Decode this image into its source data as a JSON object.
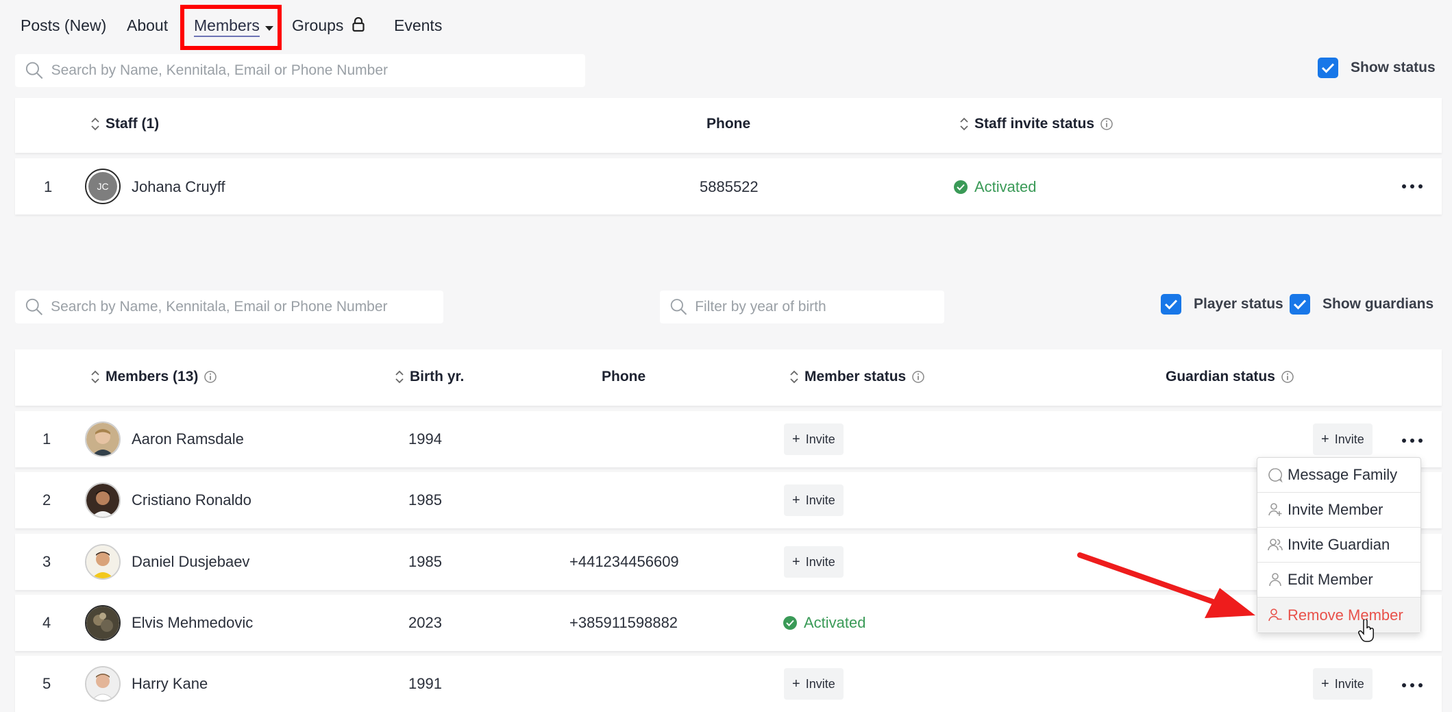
{
  "nav": {
    "items": [
      {
        "label": "Posts (New)"
      },
      {
        "label": "About"
      },
      {
        "label": "Members"
      },
      {
        "label": "Groups"
      },
      {
        "label": "Events"
      }
    ]
  },
  "staff_section": {
    "search_placeholder": "Search by Name, Kennitala, Email or Phone Number",
    "show_status_label": "Show status",
    "headers": {
      "name": "Staff (1)",
      "phone": "Phone",
      "invite_status": "Staff invite status"
    },
    "rows": [
      {
        "num": "1",
        "initials": "JC",
        "name": "Johana Cruyff",
        "phone": "5885522",
        "status": "Activated"
      }
    ]
  },
  "members_section": {
    "search_placeholder": "Search by Name, Kennitala, Email or Phone Number",
    "year_placeholder": "Filter by year of birth",
    "player_status_label": "Player status",
    "show_guardians_label": "Show guardians",
    "headers": {
      "name": "Members (13)",
      "birth": "Birth yr.",
      "phone": "Phone",
      "member_status": "Member status",
      "guardian_status": "Guardian status"
    },
    "invite_label": "Invite",
    "rows": [
      {
        "num": "1",
        "name": "Aaron Ramsdale",
        "birth": "1994",
        "phone": "",
        "member_status": "Invite",
        "guardian_status": "Invite"
      },
      {
        "num": "2",
        "name": "Cristiano Ronaldo",
        "birth": "1985",
        "phone": "",
        "member_status": "Invite",
        "guardian_status": ""
      },
      {
        "num": "3",
        "name": "Daniel Dusjebaev",
        "birth": "1985",
        "phone": "+441234456609",
        "member_status": "Invite",
        "guardian_status": ""
      },
      {
        "num": "4",
        "name": "Elvis Mehmedovic",
        "birth": "2023",
        "phone": "+385911598882",
        "member_status": "Activated",
        "guardian_status": ""
      },
      {
        "num": "5",
        "name": "Harry Kane",
        "birth": "1991",
        "phone": "",
        "member_status": "Invite",
        "guardian_status": "Invite"
      }
    ]
  },
  "context_menu": {
    "items": [
      {
        "label": "Message Family",
        "icon": "chat-bubble-icon"
      },
      {
        "label": "Invite Member",
        "icon": "user-plus-icon"
      },
      {
        "label": "Invite Guardian",
        "icon": "users-icon"
      },
      {
        "label": "Edit Member",
        "icon": "user-icon"
      },
      {
        "label": "Remove Member",
        "icon": "user-minus-icon"
      }
    ]
  },
  "colors": {
    "accent_blue": "#1877e8",
    "active_green": "#3a9a57",
    "danger_red": "#e8514a",
    "annotation_red": "#ff0000"
  }
}
